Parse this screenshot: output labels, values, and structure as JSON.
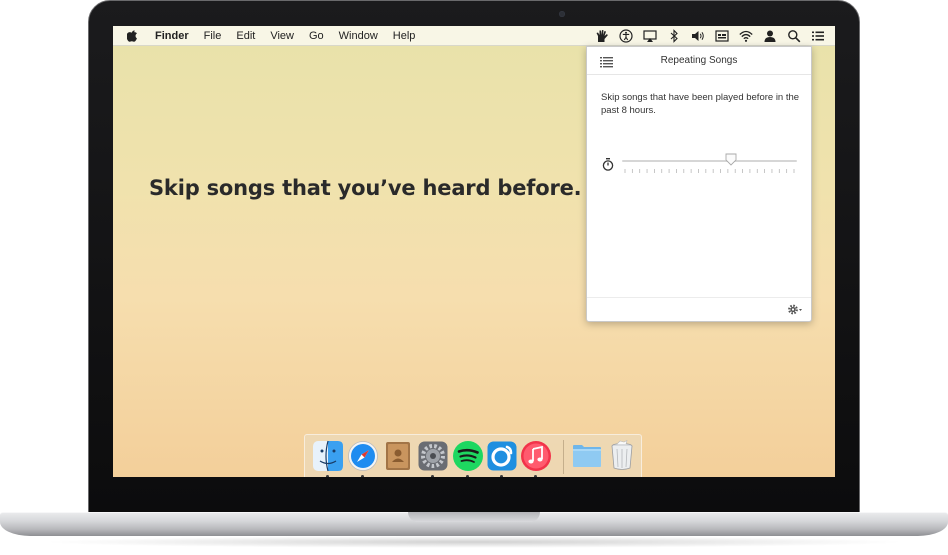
{
  "menubar": {
    "apple": "apple-menu",
    "items": [
      "Finder",
      "File",
      "Edit",
      "View",
      "Go",
      "Window",
      "Help"
    ],
    "status_icons": [
      "repeating-songs-icon",
      "accessibility-icon",
      "airplay-icon",
      "bluetooth-icon",
      "volume-icon",
      "input-menu-icon",
      "wifi-icon",
      "user-icon",
      "spotlight-icon",
      "notification-center-icon"
    ]
  },
  "desktop": {
    "headline": "Skip songs that you’ve heard before."
  },
  "popover": {
    "title": "Repeating Songs",
    "description": "Skip songs that have been played before in the past 8 hours.",
    "slider_value_fraction": 0.63,
    "slider_tick_count": 24
  },
  "dock": {
    "apps": [
      {
        "name": "finder",
        "running": true
      },
      {
        "name": "safari",
        "running": true
      },
      {
        "name": "contacts",
        "running": false
      },
      {
        "name": "system-preferences",
        "running": true
      },
      {
        "name": "spotify",
        "running": true
      },
      {
        "name": "rdio",
        "running": true
      },
      {
        "name": "itunes",
        "running": true
      },
      {
        "name": "folder",
        "running": false
      },
      {
        "name": "trash",
        "running": false
      }
    ]
  },
  "colors": {
    "spotify": "#1ed760",
    "rdio": "#1e8fe0",
    "itunes": "#f2334a",
    "safari": "#1f8cf0",
    "finder": "#3aa0f0"
  }
}
